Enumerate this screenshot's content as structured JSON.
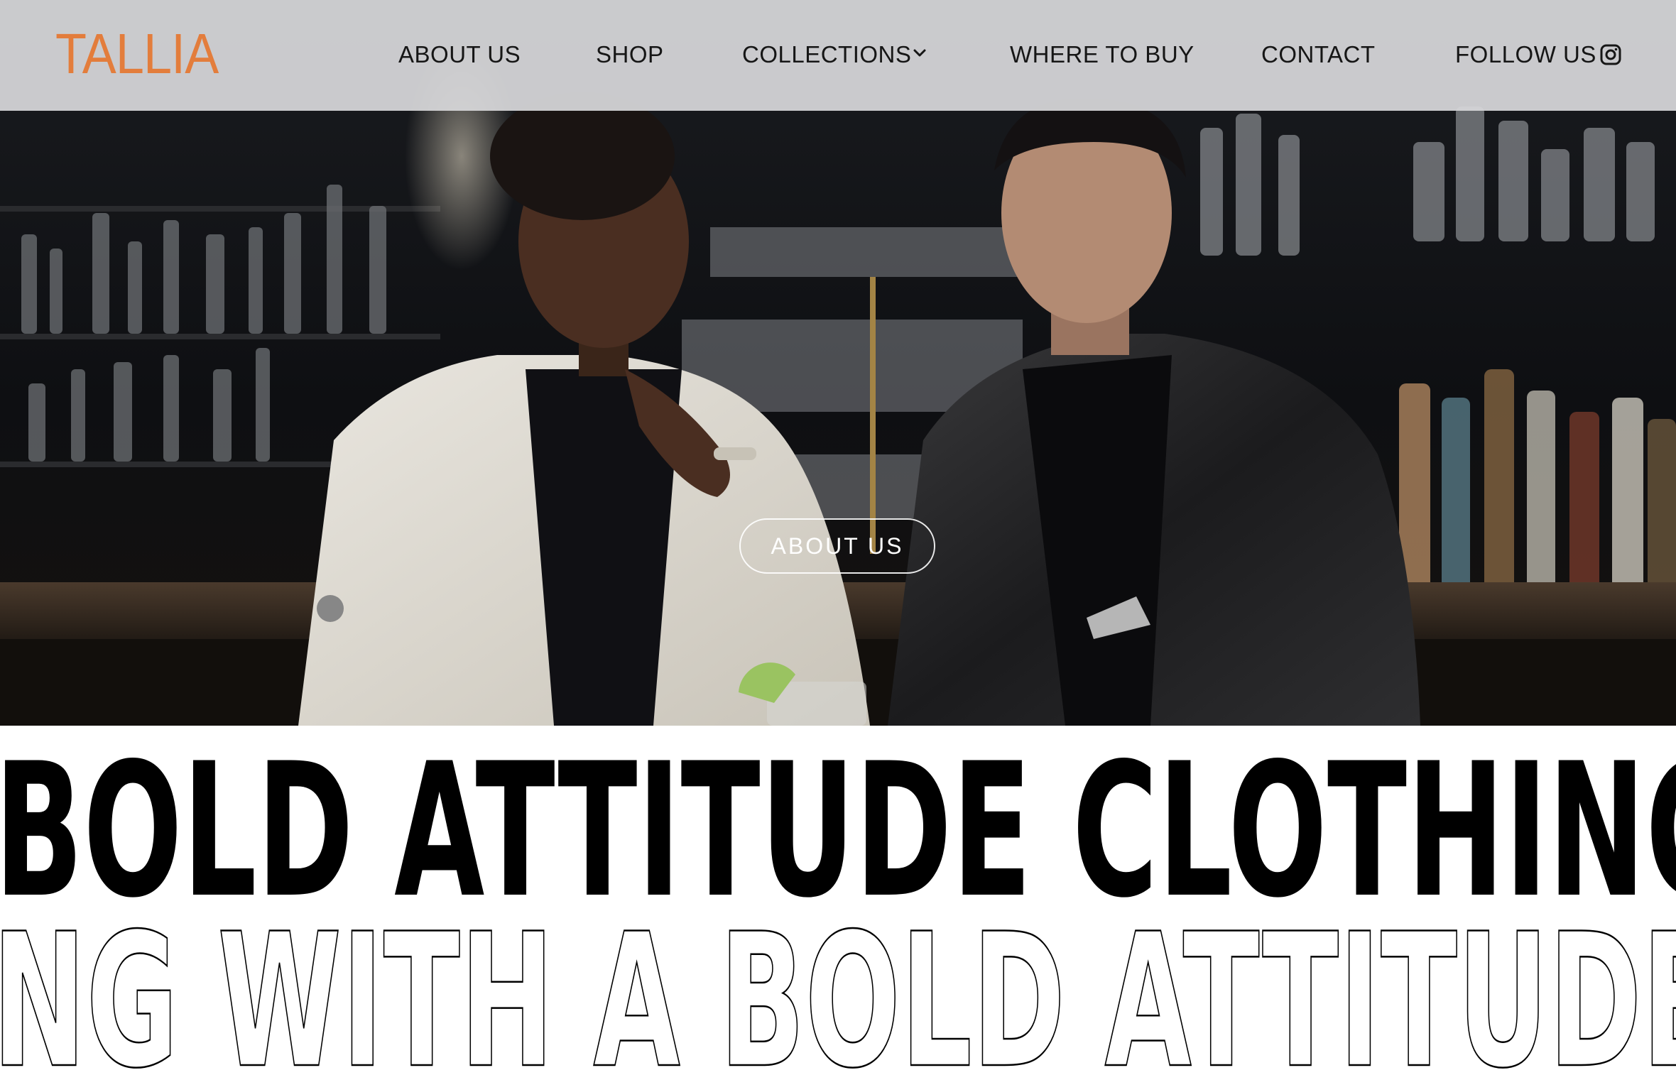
{
  "brand": {
    "logo_text": "TALLIA",
    "accent_color": "#e37d3c"
  },
  "nav": {
    "items": [
      {
        "label": "ABOUT US"
      },
      {
        "label": "SHOP"
      },
      {
        "label": "COLLECTIONS",
        "has_dropdown": true,
        "icon": "chevron-down-icon"
      },
      {
        "label": "WHERE TO BUY"
      },
      {
        "label": "CONTACT"
      },
      {
        "label": "FOLLOW US",
        "icon": "instagram-icon"
      }
    ]
  },
  "hero": {
    "cta_label": "ABOUT US",
    "image": "two men in suits standing at a bar"
  },
  "marquee": {
    "line1": "BOLD ATTITUDE CLOTHING",
    "line2": "ING WITH A BOLD ATTITUDE"
  }
}
